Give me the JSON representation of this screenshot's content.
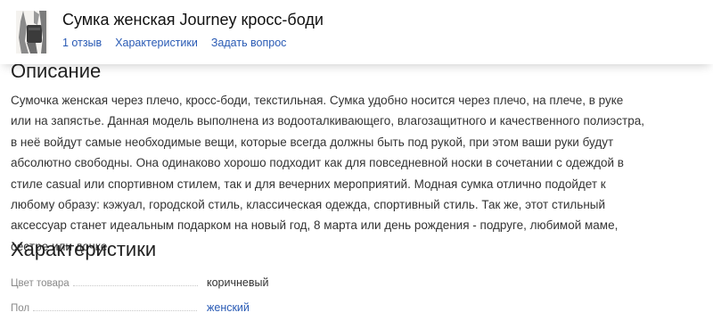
{
  "header": {
    "title": "Сумка женская Journey кросс-боди",
    "links": [
      "1 отзыв",
      "Характеристики",
      "Задать вопрос"
    ]
  },
  "description": {
    "heading": "Описание",
    "text": "Сумочка женская через плечо, кросс-боди, текстильная. Сумка удобно носится через плечо, на плече, в руке или на запястье. Данная модель выполнена из водооталкивающего, влагозащитного и качественного полиэстра, в неё войдут самые необходимые вещи, которые всегда должны быть под рукой, при этом ваши руки будут абсолютно свободны. Она одинаково хорошо подходит как для повседневной носки в сочетании с одеждой в стиле casual или спортивном стилем, так и для вечерних мероприятий. Модная сумка отлично подойдет к любому образу: кэжуал, городской стиль, классическая одежда, спортивный стиль. Так же, этот стильный аксессуар станет идеальным подарком на новый год, 8 марта или день рождения - подруге, любимой маме, сестре или дочке."
  },
  "specs": {
    "heading": "Характеристики",
    "rows": [
      {
        "name": "Цвет товара",
        "value": "коричневый",
        "is_link": false
      },
      {
        "name": "Пол",
        "value": "женский",
        "is_link": true
      }
    ]
  },
  "colors": {
    "link": "#2a5bb5",
    "spec_name": "#8a8a8a",
    "text": "#333333"
  }
}
